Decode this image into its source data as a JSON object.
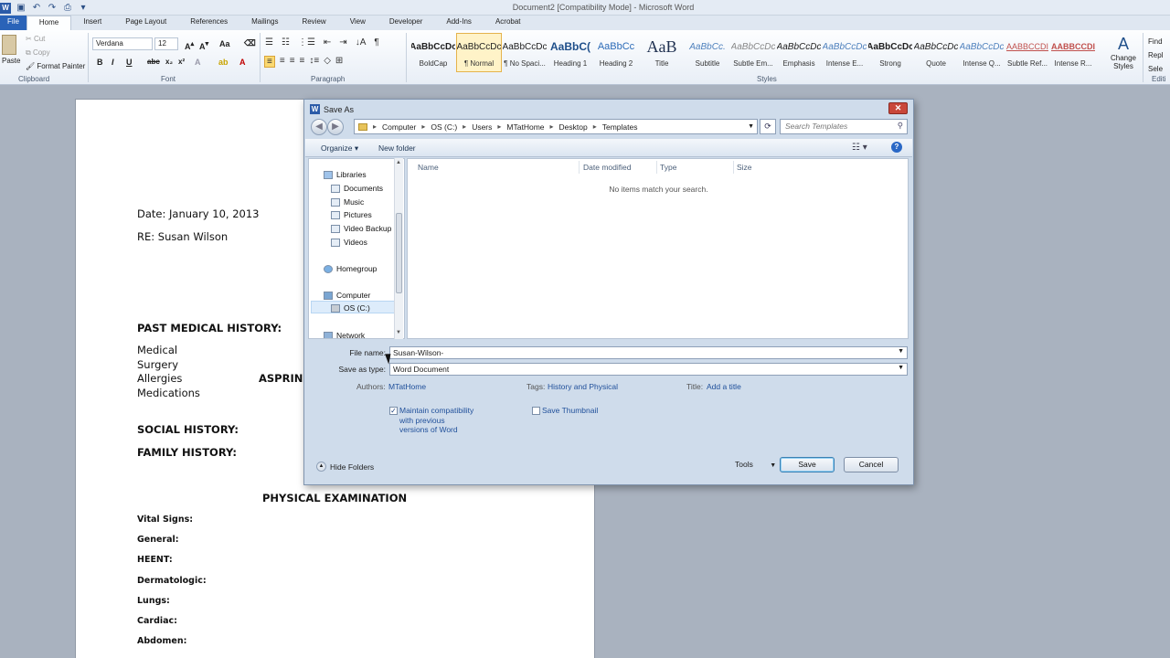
{
  "window": {
    "title": "Document2 [Compatibility Mode] - Microsoft Word"
  },
  "ribbon_tabs": [
    "File",
    "Home",
    "Insert",
    "Page Layout",
    "References",
    "Mailings",
    "Review",
    "View",
    "Developer",
    "Add-Ins",
    "Acrobat"
  ],
  "clipboard": {
    "paste": "Paste",
    "cut": "Cut",
    "copy": "Copy",
    "format_painter": "Format Painter",
    "label": "Clipboard"
  },
  "font": {
    "name": "Verdana",
    "size": "12",
    "label": "Font"
  },
  "paragraph": {
    "label": "Paragraph"
  },
  "styles": {
    "label": "Styles",
    "items": [
      {
        "sample": "AaBbCcDc",
        "name": "BoldCap"
      },
      {
        "sample": "AaBbCcDc",
        "name": "¶ Normal"
      },
      {
        "sample": "AaBbCcDc",
        "name": "¶ No Spaci..."
      },
      {
        "sample": "AaBbC(",
        "name": "Heading 1"
      },
      {
        "sample": "AaBbCc",
        "name": "Heading 2"
      },
      {
        "sample": "AaB",
        "name": "Title"
      },
      {
        "sample": "AaBbCc.",
        "name": "Subtitle"
      },
      {
        "sample": "AaBbCcDc",
        "name": "Subtle Em..."
      },
      {
        "sample": "AaBbCcDc",
        "name": "Emphasis"
      },
      {
        "sample": "AaBbCcDc",
        "name": "Intense E..."
      },
      {
        "sample": "AaBbCcDc",
        "name": "Strong"
      },
      {
        "sample": "AaBbCcDc",
        "name": "Quote"
      },
      {
        "sample": "AaBbCcDc",
        "name": "Intense Q..."
      },
      {
        "sample": "AABBCCDI",
        "name": "Subtle Ref..."
      },
      {
        "sample": "AABBCCDI",
        "name": "Intense R..."
      }
    ],
    "change_styles": "Change Styles"
  },
  "editing": {
    "find": "Find",
    "replace": "Repl",
    "select": "Sele",
    "label": "Editi"
  },
  "document": {
    "date_line": "Date: January 10, 2013",
    "re_line": "RE: Susan Wilson",
    "pmh_heading": "PAST MEDICAL HISTORY:",
    "medical": "Medical",
    "surgery": "Surgery",
    "allergies": "Allergies",
    "allergy_value": "ASPRIN",
    "medications": "Medications",
    "social": "SOCIAL HISTORY:",
    "family": "FAMILY HISTORY:",
    "exam_heading": "PHYSICAL EXAMINATION",
    "exam_items": [
      "Vital Signs:",
      "General:",
      "HEENT:",
      "Dermatologic:",
      "Lungs:",
      "Cardiac:",
      "Abdomen:"
    ]
  },
  "dialog": {
    "title": "Save As",
    "breadcrumb": [
      "Computer",
      "OS (C:)",
      "Users",
      "MTatHome",
      "Desktop",
      "Templates"
    ],
    "search_placeholder": "Search Templates",
    "organize": "Organize ▾",
    "new_folder": "New folder",
    "nav": {
      "libraries": "Libraries",
      "documents": "Documents",
      "music": "Music",
      "pictures": "Pictures",
      "video_backup": "Video Backup",
      "videos": "Videos",
      "homegroup": "Homegroup",
      "computer": "Computer",
      "os_c": "OS (C:)",
      "network": "Network"
    },
    "columns": [
      "Name",
      "Date modified",
      "Type",
      "Size"
    ],
    "empty_message": "No items match your search.",
    "file_name_label": "File name:",
    "file_name_value": "Susan-Wilson-",
    "save_type_label": "Save as type:",
    "save_type_value": "Word Document",
    "authors_label": "Authors:",
    "authors_value": "MTatHome",
    "tags_label": "Tags:",
    "tags_value": "History and Physical",
    "title_label": "Title:",
    "title_value": "Add a title",
    "maintain_compat": "Maintain compatibility with previous versions of Word",
    "maintain_checked": true,
    "save_thumbnail": "Save Thumbnail",
    "hide_folders": "Hide Folders",
    "tools": "Tools",
    "save": "Save",
    "cancel": "Cancel"
  }
}
